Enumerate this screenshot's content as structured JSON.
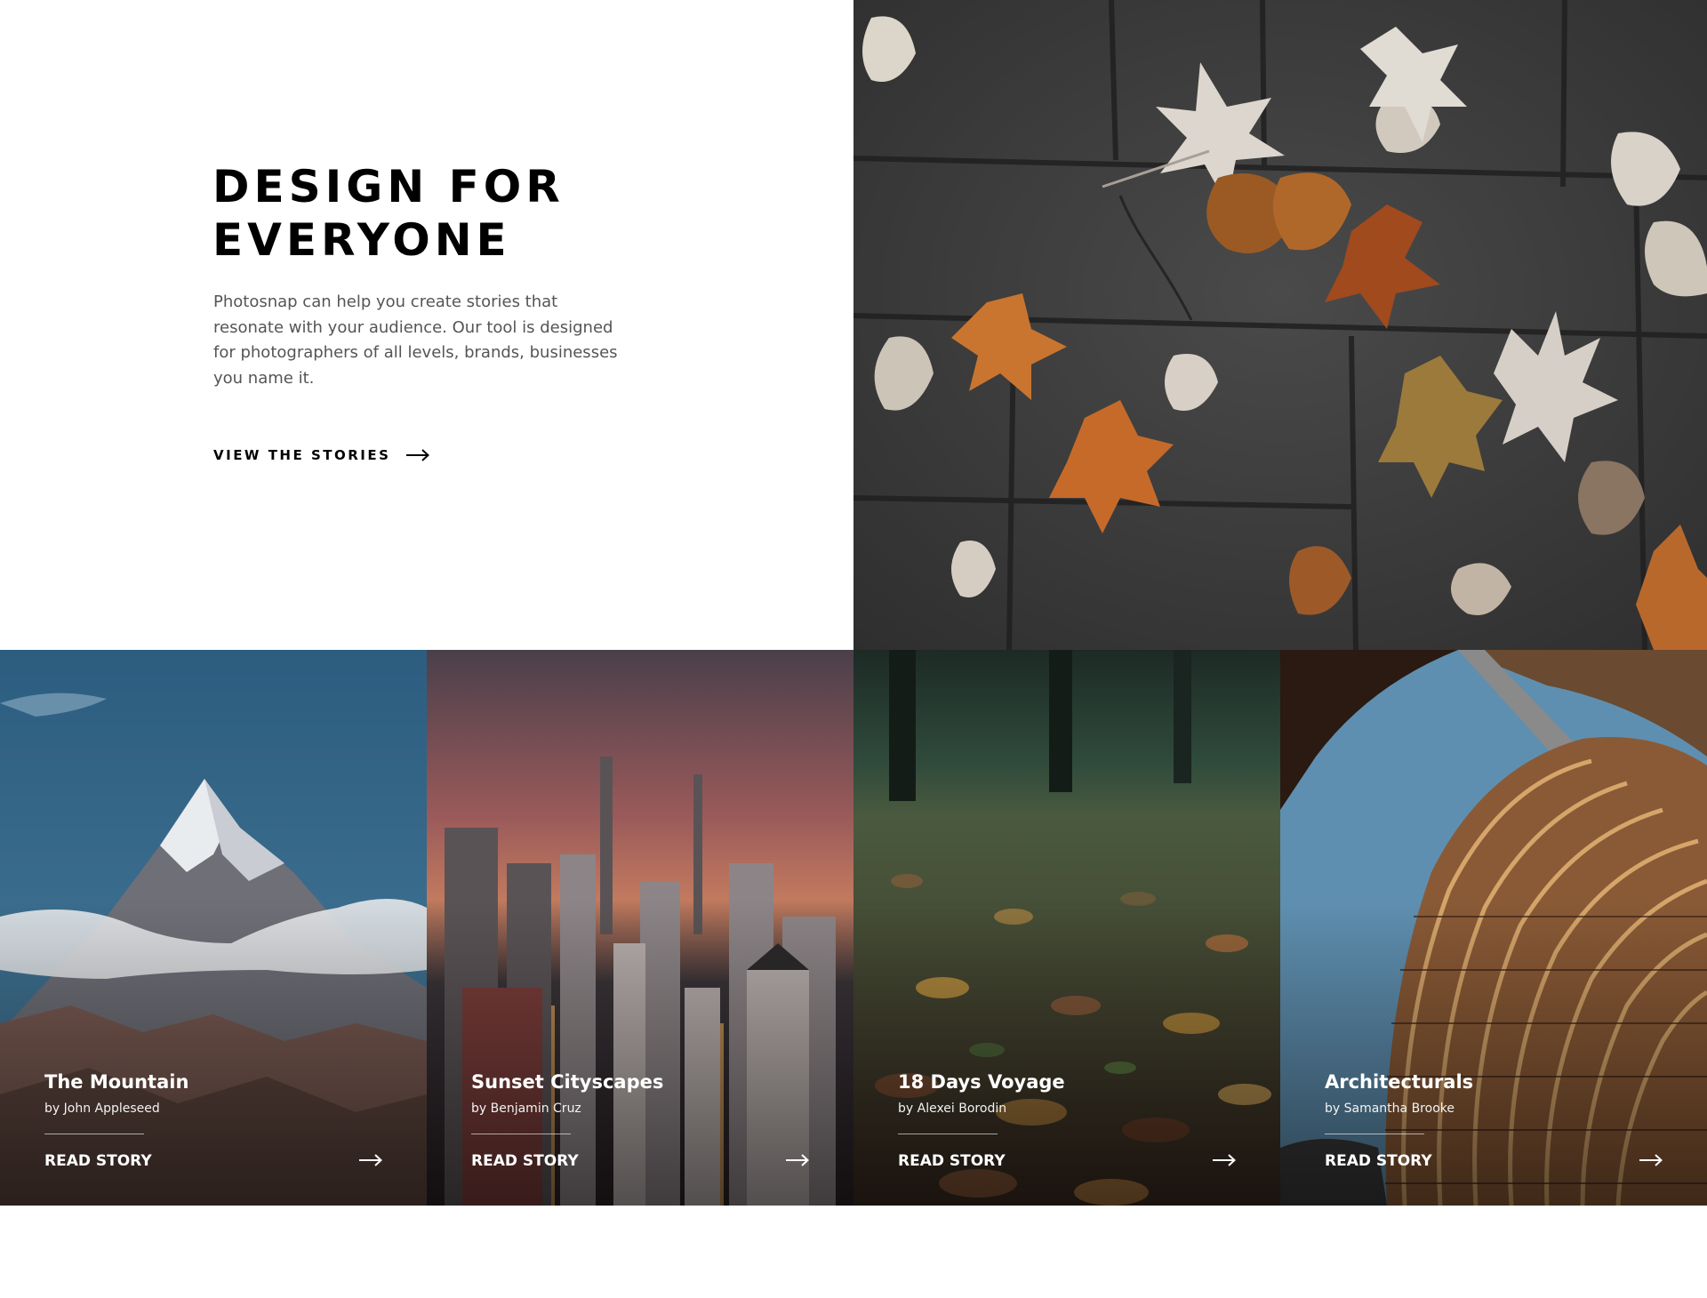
{
  "hero": {
    "title": "DESIGN FOR\nEVERYONE",
    "description": "Photosnap can help you create stories that resonate with your audience. Our tool is designed for photographers of all levels, brands, businesses you name it.",
    "cta_label": "VIEW THE STORIES",
    "cta_icon": "arrow-right-icon",
    "image": "autumn-leaves-on-pavement"
  },
  "stories": [
    {
      "title": "The Mountain",
      "author": "by John Appleseed",
      "cta_label": "READ STORY",
      "image": "snowy-mountain-peak"
    },
    {
      "title": "Sunset Cityscapes",
      "author": "by Benjamin Cruz",
      "cta_label": "READ STORY",
      "image": "city-skyline-at-sunset"
    },
    {
      "title": "18 Days Voyage",
      "author": "by Alexei Borodin",
      "cta_label": "READ STORY",
      "image": "fallen-leaves-forest-path"
    },
    {
      "title": "Architecturals",
      "author": "by Samantha Brooke",
      "cta_label": "READ STORY",
      "image": "curved-building-facade"
    }
  ],
  "colors": {
    "text_dark": "#000000",
    "text_body": "#555555",
    "card_text": "#ffffff",
    "background": "#ffffff"
  }
}
